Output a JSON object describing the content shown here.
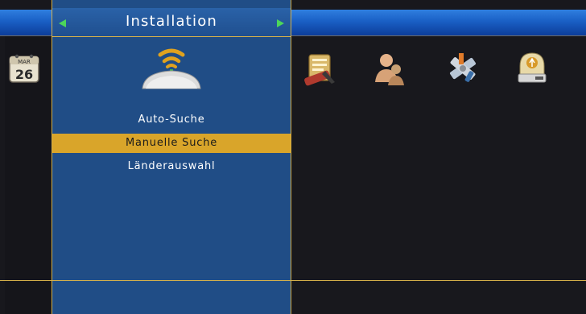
{
  "panel": {
    "title": "Installation",
    "items": [
      {
        "label": "Auto-Suche",
        "selected": false
      },
      {
        "label": "Manuelle Suche",
        "selected": true
      },
      {
        "label": "Länderauswahl",
        "selected": false
      }
    ]
  },
  "calendar": {
    "month": "MAR",
    "day": "26"
  },
  "icons": {
    "left": "calendar-icon",
    "panel": "antenna-icon",
    "right": [
      "notes-icon",
      "users-icon",
      "tools-icon",
      "usb-drive-icon"
    ]
  },
  "colors": {
    "accent": "#d9a52a",
    "panel": "#204d86",
    "top_bar": "#1a5fc4",
    "arrow": "#4cd65a"
  }
}
